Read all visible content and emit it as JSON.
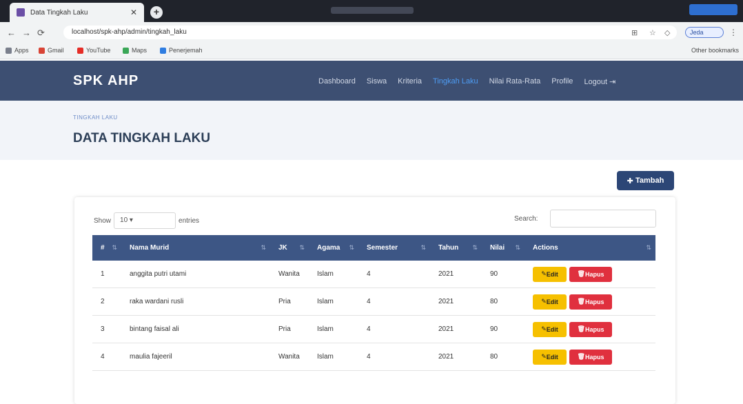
{
  "browser": {
    "tab_title": "Data Tingkah Laku",
    "url": "localhost/spk-ahp/admin/tingkah_laku",
    "profile_label": "Jeda",
    "bookmarks": [
      "Apps",
      "Gmail",
      "YouTube",
      "Maps",
      "Penerjemah"
    ],
    "bookmarks_right": "Other bookmarks"
  },
  "nav": {
    "brand": "SPK AHP",
    "items": [
      "Dashboard",
      "Siswa",
      "Kriteria",
      "Tingkah Laku",
      "Nilai Rata-Rata",
      "Profile",
      "Logout"
    ],
    "active_index": 3
  },
  "page": {
    "breadcrumb": "TINGKAH LAKU",
    "title": "DATA TINGKAH LAKU",
    "add_button": "Tambah"
  },
  "table": {
    "show_label": "Show",
    "length_value": "10",
    "entries_label": "entries",
    "search_label": "Search:",
    "columns": [
      "#",
      "Nama Murid",
      "JK",
      "Agama",
      "Semester",
      "Tahun",
      "Nilai",
      "Actions"
    ],
    "rows": [
      {
        "no": "1",
        "nama": "anggita putri utami",
        "jk": "Wanita",
        "agama": "Islam",
        "semester": "4",
        "tahun": "2021",
        "nilai": "90",
        "edit": "Edit",
        "delete": "Hapus"
      },
      {
        "no": "2",
        "nama": "raka wardani rusli",
        "jk": "Pria",
        "agama": "Islam",
        "semester": "4",
        "tahun": "2021",
        "nilai": "80",
        "edit": "Edit",
        "delete": "Hapus"
      },
      {
        "no": "3",
        "nama": "bintang faisal ali",
        "jk": "Pria",
        "agama": "Islam",
        "semester": "4",
        "tahun": "2021",
        "nilai": "90",
        "edit": "Edit",
        "delete": "Hapus"
      },
      {
        "no": "4",
        "nama": "maulia fajeeril",
        "jk": "Wanita",
        "agama": "Islam",
        "semester": "4",
        "tahun": "2021",
        "nilai": "80",
        "edit": "Edit",
        "delete": "Hapus"
      }
    ]
  },
  "colors": {
    "navbar": "#3d4f72",
    "table_header": "#3d5685",
    "edit": "#f6c000",
    "delete": "#e0303e",
    "active_nav": "#4e9df5"
  }
}
